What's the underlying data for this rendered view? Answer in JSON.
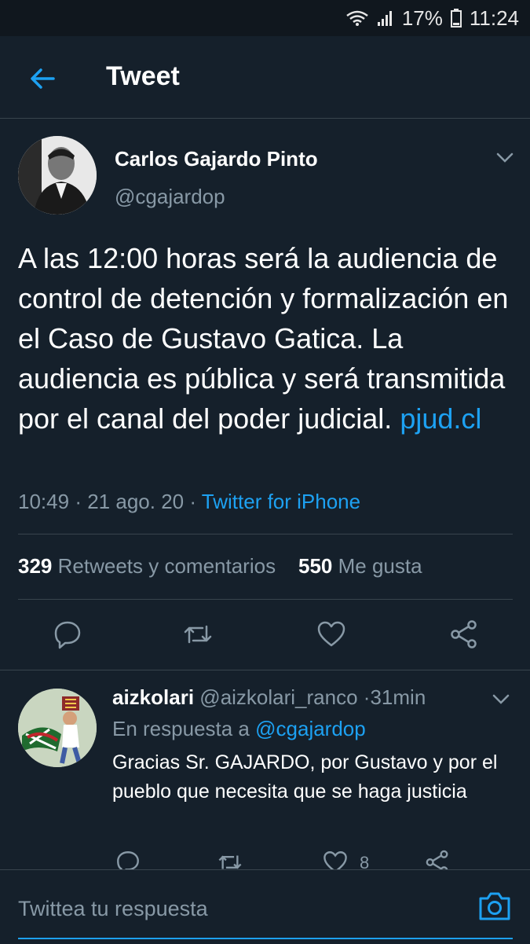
{
  "status_bar": {
    "battery_percent": "17%",
    "time": "11:24"
  },
  "header": {
    "title": "Tweet"
  },
  "tweet": {
    "author_name": "Carlos Gajardo Pinto",
    "author_handle": "@cgajardop",
    "text": "A las 12:00 horas será la audiencia de control de detención y formalización en el Caso de Gustavo Gatica. La audiencia es pública y será transmitida por el canal del poder judicial. ",
    "link": "pjud.cl",
    "time": "10:49",
    "date": "21 ago. 20",
    "dot": "·",
    "source": "Twitter for iPhone",
    "retweets_count": "329",
    "retweets_label": "Retweets y comentarios",
    "likes_count": "550",
    "likes_label": "Me gusta"
  },
  "reply": {
    "name": "aizkolari",
    "handle": "@aizkolari_ranco",
    "dot": "·",
    "age": "31min",
    "in_reply_prefix": "En respuesta a",
    "in_reply_handle": "@cgajardop",
    "text": "Gracias Sr. GAJARDO, por Gustavo y por el pueblo que necesita que se haga justicia",
    "like_count": "8"
  },
  "composer": {
    "placeholder": "Twittea tu respuesta"
  },
  "colors": {
    "background": "#15202b",
    "accent": "#1da1f2",
    "secondary_text": "#8899a6",
    "divider": "#38444d"
  }
}
